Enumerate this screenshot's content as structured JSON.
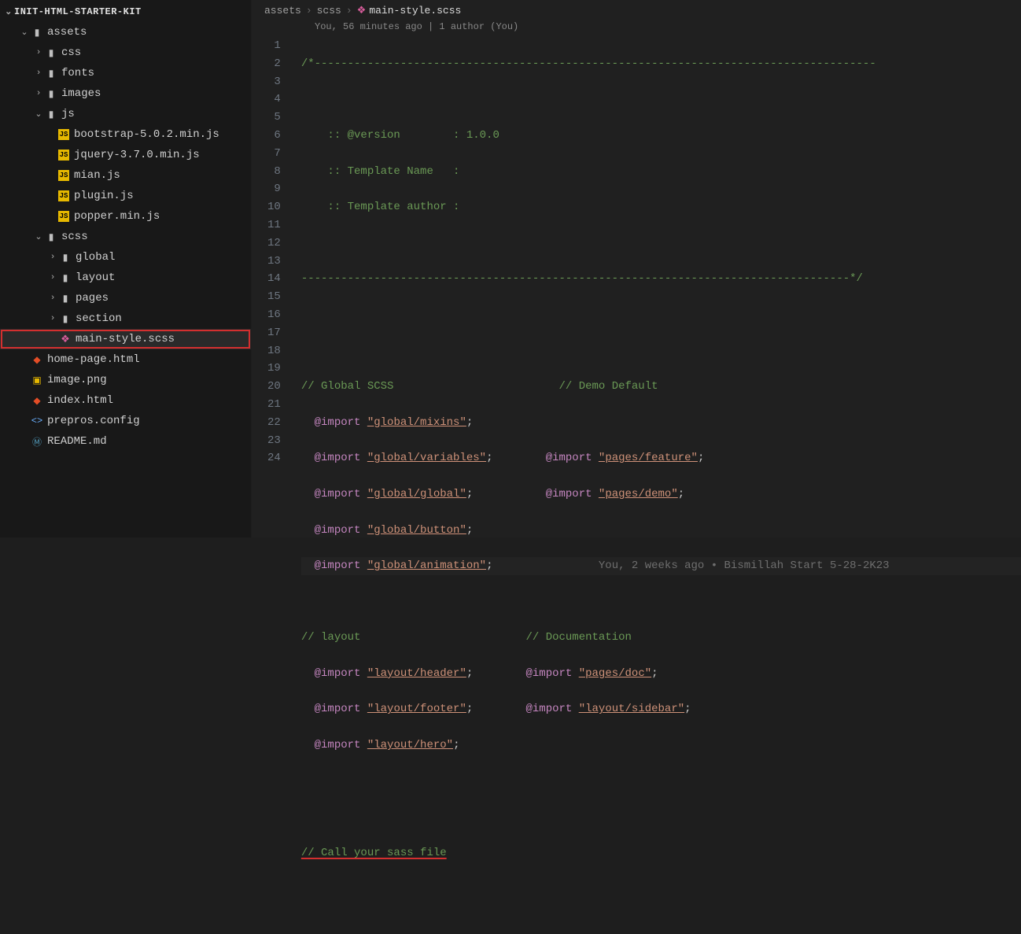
{
  "project_title": "INIT-HTML-STARTER-KIT",
  "sidebar": {
    "rows": [
      {
        "indent": 0,
        "chev": "v",
        "type": "title",
        "label": "INIT-HTML-STARTER-KIT"
      },
      {
        "indent": 1,
        "chev": "v",
        "type": "folder",
        "label": "assets"
      },
      {
        "indent": 2,
        "chev": ">",
        "type": "folder",
        "label": "css"
      },
      {
        "indent": 2,
        "chev": ">",
        "type": "folder",
        "label": "fonts"
      },
      {
        "indent": 2,
        "chev": ">",
        "type": "folder",
        "label": "images"
      },
      {
        "indent": 2,
        "chev": "v",
        "type": "folder",
        "label": "js"
      },
      {
        "indent": 3,
        "chev": "",
        "type": "js",
        "label": "bootstrap-5.0.2.min.js"
      },
      {
        "indent": 3,
        "chev": "",
        "type": "js",
        "label": "jquery-3.7.0.min.js"
      },
      {
        "indent": 3,
        "chev": "",
        "type": "js",
        "label": "mian.js"
      },
      {
        "indent": 3,
        "chev": "",
        "type": "js",
        "label": "plugin.js"
      },
      {
        "indent": 3,
        "chev": "",
        "type": "js",
        "label": "popper.min.js"
      },
      {
        "indent": 2,
        "chev": "v",
        "type": "folder",
        "label": "scss"
      },
      {
        "indent": 3,
        "chev": ">",
        "type": "folder",
        "label": "global"
      },
      {
        "indent": 3,
        "chev": ">",
        "type": "folder",
        "label": "layout"
      },
      {
        "indent": 3,
        "chev": ">",
        "type": "folder",
        "label": "pages"
      },
      {
        "indent": 3,
        "chev": ">",
        "type": "folder",
        "label": "section"
      },
      {
        "indent": 3,
        "chev": "",
        "type": "scss",
        "label": "main-style.scss",
        "selected": true
      },
      {
        "indent": 1,
        "chev": "",
        "type": "html",
        "label": "home-page.html"
      },
      {
        "indent": 1,
        "chev": "",
        "type": "img",
        "label": "image.png"
      },
      {
        "indent": 1,
        "chev": "",
        "type": "html",
        "label": "index.html"
      },
      {
        "indent": 1,
        "chev": "",
        "type": "json",
        "label": "prepros.config"
      },
      {
        "indent": 1,
        "chev": "",
        "type": "md",
        "label": "README.md"
      }
    ]
  },
  "breadcrumb": [
    "assets",
    "scss",
    "main-style.scss"
  ],
  "blame_header": "You, 56 minutes ago | 1 author (You)",
  "code": {
    "dash_open": "/*-------------------------------------------------------------------------------------",
    "version_line": "    :: @version        : 1.0.0",
    "tmpl_name_line": "    :: Template Name   :",
    "tmpl_auth_line": "    :: Template author :",
    "dash_close": "-----------------------------------------------------------------------------------*/",
    "c_global": "// Global SCSS",
    "c_demo": "// Demo Default",
    "imp": "@import",
    "s_mixins": "\"global/mixins\"",
    "s_variables": "\"global/variables\"",
    "s_global": "\"global/global\"",
    "s_button": "\"global/button\"",
    "s_animation": "\"global/animation\"",
    "s_feature": "\"pages/feature\"",
    "s_demo": "\"pages/demo\"",
    "blame_inline": "You, 2 weeks ago • Bismillah Start 5-28-2K23",
    "c_layout": "// layout",
    "c_docs": "// Documentation",
    "s_header": "\"layout/header\"",
    "s_footer": "\"layout/footer\"",
    "s_hero": "\"layout/hero\"",
    "s_doc": "\"pages/doc\"",
    "s_sidebar": "\"layout/sidebar\"",
    "c_call": "// Call your sass file",
    "semi": ";"
  },
  "line_numbers": [
    "1",
    "2",
    "3",
    "4",
    "5",
    "6",
    "7",
    "8",
    "9",
    "10",
    "11",
    "12",
    "13",
    "14",
    "15",
    "16",
    "17",
    "18",
    "19",
    "20",
    "21",
    "22",
    "23",
    "24"
  ]
}
